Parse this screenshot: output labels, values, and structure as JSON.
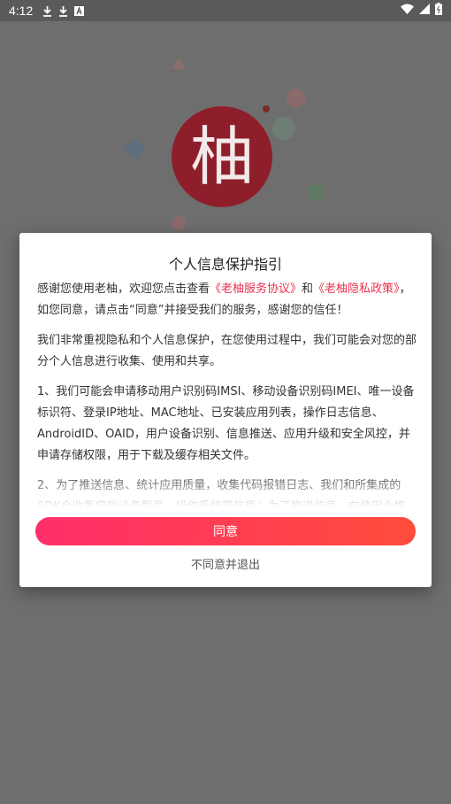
{
  "status_bar": {
    "time": "4:12",
    "left_icons": [
      "download-icon",
      "download-icon",
      "notification-a-icon"
    ],
    "right_icons": [
      "wifi-icon",
      "signal-icon",
      "battery-icon"
    ]
  },
  "background": {
    "logo_char": "柚",
    "logo_color": "#8e1f2a"
  },
  "dialog": {
    "title": "个人信息保护指引",
    "intro_pre": "感谢您使用老柚，欢迎您点击查看",
    "link_service": "《老柚服务协议》",
    "intro_and": "和",
    "link_privacy": "《老柚隐私政策》",
    "intro_post": "，如您同意，请点击“同意”并接受我们的服务，感谢您的信任！",
    "para2": "我们非常重视隐私和个人信息保护，在您使用过程中，我们可能会对您的部分个人信息进行收集、使用和共享。",
    "para3": "1、我们可能会申请移动用户识别码IMSI、移动设备识别码IMEI、唯一设备标识符、登录IP地址、MAC地址、已安装应用列表，操作日志信息、AndroidID、OAID，用户设备识别、信息推送、应用升级和安全风控，并申请存储权限，用于下载及缓存相关文件。",
    "para4": "2、为了推送信息、统计应用质量，收集代码报错日志、我们和所集成的SDK会收集您的设备型号、操作系统等信息；为了推送信息，在使用个推",
    "agree_label": "同意",
    "disagree_label": "不同意并退出"
  },
  "colors": {
    "accent_start": "#ff2e6a",
    "accent_end": "#ff4c3b",
    "link": "#e8324f"
  }
}
